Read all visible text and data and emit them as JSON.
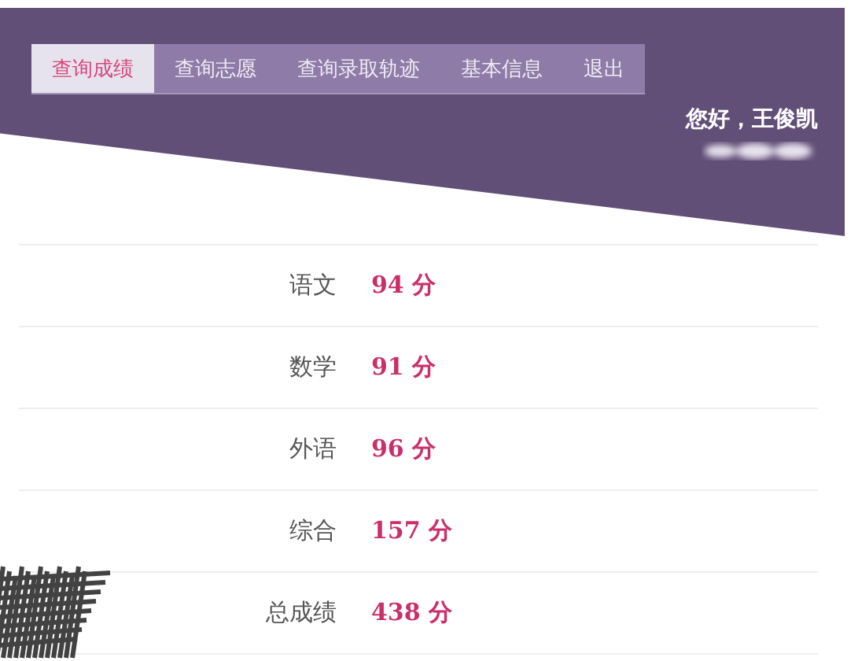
{
  "nav": [
    {
      "label": "查询成绩",
      "selected": true
    },
    {
      "label": "查询志愿",
      "selected": false
    },
    {
      "label": "查询录取轨迹",
      "selected": false
    },
    {
      "label": "基本信息",
      "selected": false
    },
    {
      "label": "退出",
      "selected": false
    }
  ],
  "greeting": "您好，王俊凯",
  "scores": [
    {
      "subject": "语文",
      "score": "94 分"
    },
    {
      "subject": "数学",
      "score": "91 分"
    },
    {
      "subject": "外语",
      "score": "96 分"
    },
    {
      "subject": "综合",
      "score": "157 分"
    },
    {
      "subject": "总成绩",
      "score": "438 分"
    }
  ]
}
